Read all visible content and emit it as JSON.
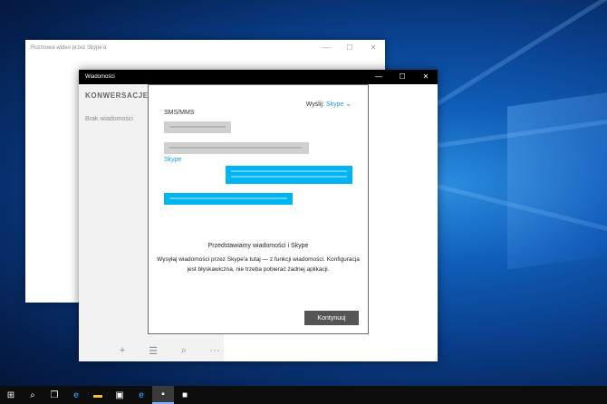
{
  "back_window": {
    "title": "Rozmowa wideo przez Skype'a"
  },
  "front_window": {
    "title": "Wiadomości"
  },
  "window_controls": {
    "minimize": "—",
    "maximize": "☐",
    "close": "✕"
  },
  "sidebar": {
    "heading": "KONWERSACJE",
    "empty_text": "Brak wiadomości",
    "tools": [
      "+",
      "☰",
      "⌕",
      "···"
    ]
  },
  "dialog": {
    "send_label": "Wyślij:",
    "send_value": "Skype",
    "sms_label": "SMS/MMS",
    "skype_label": "Skype",
    "intro_title": "Przedstawiamy wiadomości i Skype",
    "intro_body": "Wysyłaj wiadomości przez Skype'a tutaj — z funkcji wiadomości. Konfiguracja jest błyskawiczna, nie trzeba pobierać żadnej aplikacji.",
    "continue_button": "Kontynuuj"
  },
  "taskbar": {
    "items": [
      {
        "icon": "windows-start-icon",
        "glyph": "⊞"
      },
      {
        "icon": "search-icon",
        "glyph": "⌕"
      },
      {
        "icon": "task-view-icon",
        "glyph": "❐"
      },
      {
        "icon": "edge-icon",
        "glyph": "e"
      },
      {
        "icon": "file-explorer-icon",
        "glyph": "▬"
      },
      {
        "icon": "store-icon",
        "glyph": "▣"
      },
      {
        "icon": "ie-icon",
        "glyph": "e"
      },
      {
        "icon": "messaging-icon",
        "glyph": "▪"
      },
      {
        "icon": "skype-video-icon",
        "glyph": "■"
      }
    ]
  },
  "colors": {
    "accent": "#1a9be0",
    "taskbar": "#0d0d0d",
    "sms_bubble": "#d0d0d0"
  }
}
